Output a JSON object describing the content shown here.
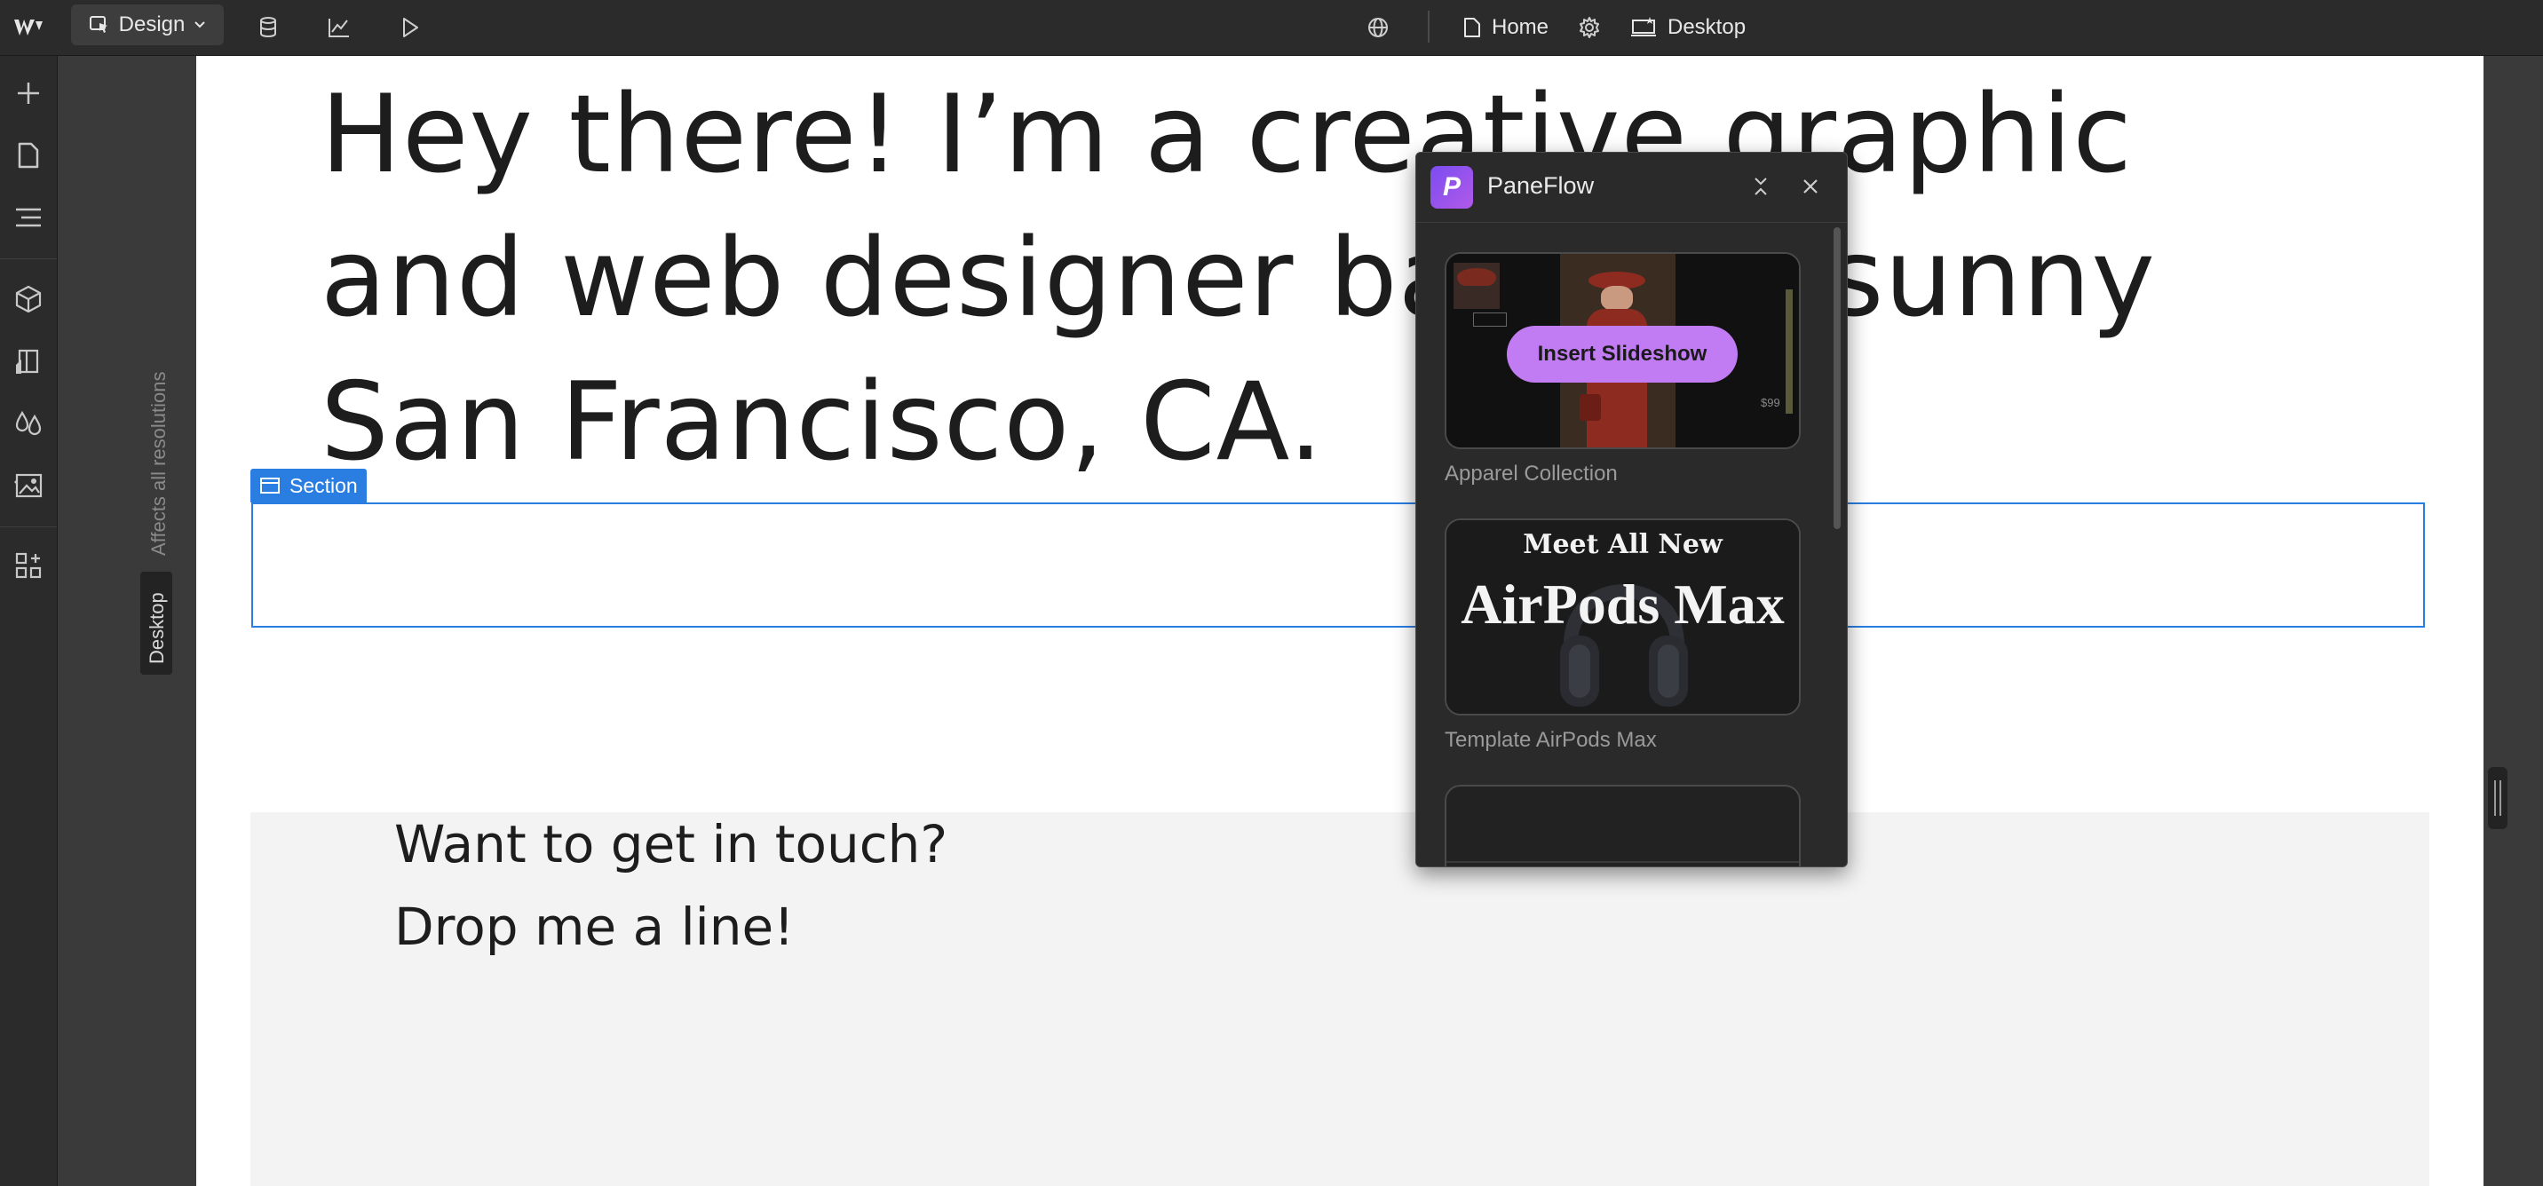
{
  "topbar": {
    "mode_label": "Design",
    "page_label": "Home",
    "breakpoint_label": "Desktop"
  },
  "gutter": {
    "affects_label": "Affects all resolutions",
    "desktop_label": "Desktop"
  },
  "canvas": {
    "hero_text": "Hey there! I’m a creative graphic and web designer based in sunny San Francisco, CA.",
    "section_tag": "Section",
    "contact_line1": "Want to get in touch?",
    "contact_line2": "Drop me a line!"
  },
  "panel": {
    "title": "PaneFlow",
    "insert_button": "Insert Slideshow",
    "templates": [
      {
        "label": "Apparel Collection",
        "preview_price": "$99"
      },
      {
        "label": "Template AirPods Max",
        "preview_line1": "Meet All New",
        "preview_line2": "AirPods Max"
      }
    ]
  },
  "colors": {
    "accent": "#2a7de1",
    "panel_button": "#c17cf3",
    "panel_logo": "#7b4cf0"
  }
}
